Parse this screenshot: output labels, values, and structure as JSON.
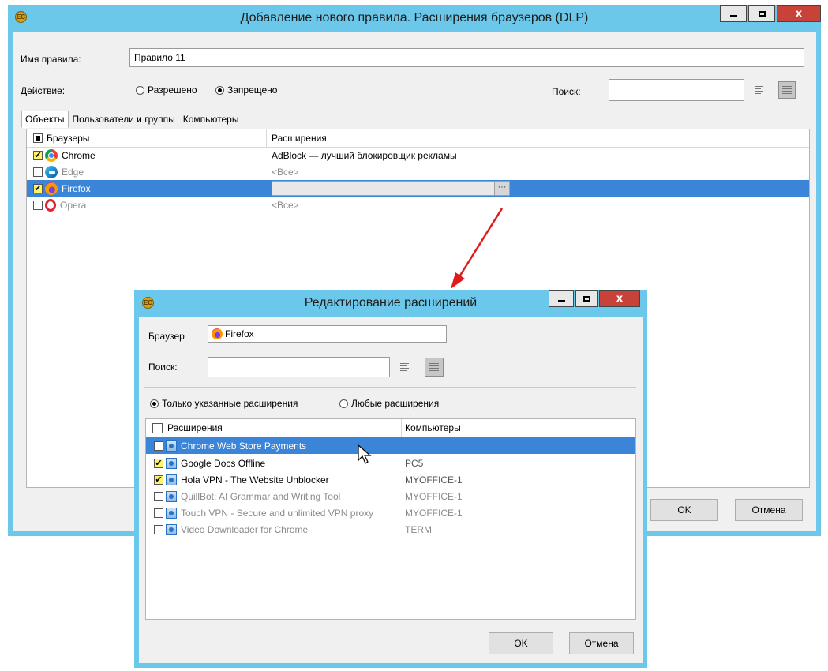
{
  "main_window": {
    "title": "Добавление нового правила. Расширения браузеров (DLP)",
    "rule_name_label": "Имя правила:",
    "rule_name_value": "Правило 11",
    "action_label": "Действие:",
    "action_allowed": "Разрешено",
    "action_denied": "Запрещено",
    "action_selected": "Запрещено",
    "search_label": "Поиск:",
    "search_value": "",
    "tabs": [
      "Объекты",
      "Пользователи и группы",
      "Компьютеры"
    ],
    "active_tab": "Объекты",
    "columns": [
      "Браузеры",
      "Расширения"
    ],
    "rows": [
      {
        "browser": "Chrome",
        "checked": true,
        "extensions": "AdBlock — лучший блокировщик рекламы"
      },
      {
        "browser": "Edge",
        "checked": false,
        "extensions": "<Все>"
      },
      {
        "browser": "Firefox",
        "checked": true,
        "extensions": ""
      },
      {
        "browser": "Opera",
        "checked": false,
        "extensions": "<Все>"
      }
    ],
    "ellipsis": "···",
    "ok": "OK",
    "cancel": "Отмена"
  },
  "sub_dialog": {
    "title": "Редактирование расширений",
    "browser_label": "Браузер",
    "browser_value": "Firefox",
    "search_label": "Поиск:",
    "search_value": "",
    "mode_only": "Только указанные расширения",
    "mode_any": "Любые расширения",
    "mode_selected": "Только указанные расширения",
    "columns": [
      "Расширения",
      "Компьютеры"
    ],
    "rows": [
      {
        "name": "Chrome Web Store Payments",
        "computers": "",
        "checked": false,
        "selected": true
      },
      {
        "name": "Google Docs Offline",
        "computers": "PC5",
        "checked": true
      },
      {
        "name": "Hola VPN - The Website Unblocker",
        "computers": "MYOFFICE-1",
        "checked": true
      },
      {
        "name": "QuillBot: AI Grammar and Writing Tool",
        "computers": "MYOFFICE-1",
        "checked": false
      },
      {
        "name": "Touch VPN - Secure and unlimited VPN proxy",
        "computers": "MYOFFICE-1",
        "checked": false
      },
      {
        "name": "Video Downloader for Chrome",
        "computers": "TERM",
        "checked": false
      }
    ],
    "ok": "OK",
    "cancel": "Отмена"
  },
  "icons": {
    "app": "app-logo-icon",
    "chrome": "chrome-icon",
    "edge": "edge-icon",
    "firefox": "firefox-icon",
    "opera": "opera-icon",
    "extension": "extension-icon"
  },
  "colors": {
    "title_bar": "#6cc8ea",
    "selection": "#3a85d7",
    "check_fill": "#fff36a",
    "close_button": "#c94239",
    "arrow": "#e01b1b"
  }
}
